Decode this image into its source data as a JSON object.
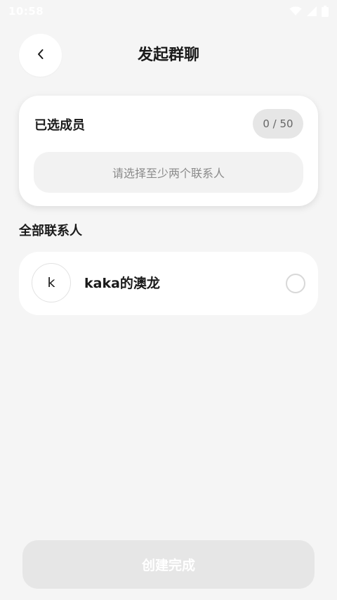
{
  "status_bar": {
    "time": "10:58",
    "icons": [
      "wifi-icon",
      "signal-icon",
      "battery-icon"
    ]
  },
  "header": {
    "title": "发起群聊",
    "back_icon": "chevron-left-icon"
  },
  "selected_members": {
    "title": "已选成员",
    "count": "0 / 50",
    "empty_hint": "请选择至少两个联系人"
  },
  "contacts": {
    "section_title": "全部联系人",
    "items": [
      {
        "avatar_initial": "k",
        "name": "kaka的澳龙",
        "selected": false
      }
    ]
  },
  "footer": {
    "create_label": "创建完成",
    "create_enabled": false
  },
  "colors": {
    "background": "#f5f5f5",
    "card": "#ffffff",
    "badge_bg": "#e6e6e6",
    "hint_bg": "#f2f2f2",
    "disabled_button_bg": "#e6e6e6",
    "disabled_button_text": "#ffffff"
  }
}
